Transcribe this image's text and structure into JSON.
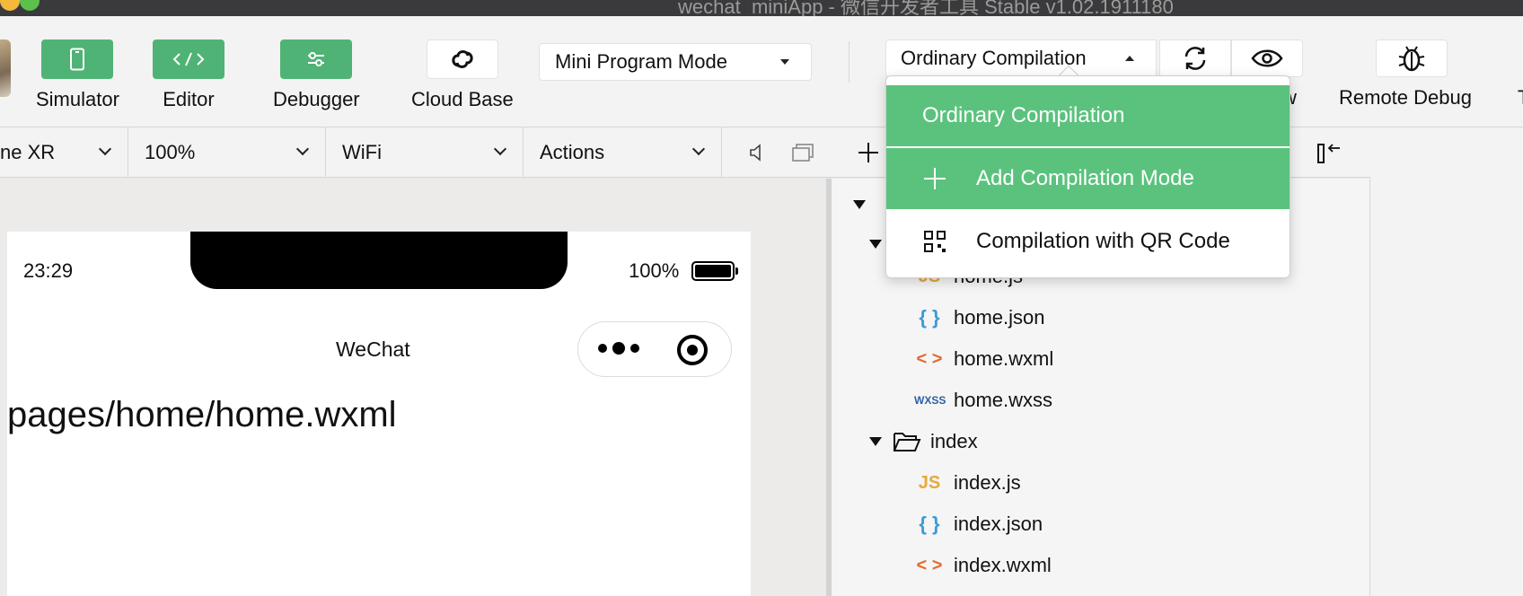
{
  "window": {
    "title": "wechat_miniApp - 微信开发者工具 Stable v1.02.1911180"
  },
  "toolbar": {
    "simulator_label": "Simulator",
    "editor_label": "Editor",
    "debugger_label": "Debugger",
    "cloud_label": "Cloud Base",
    "mode_value": "Mini Program Mode",
    "compile_value": "Ordinary Compilation",
    "preview_label_partial": "w",
    "remote_debug_label": "Remote Debug",
    "more_label_partial": "T"
  },
  "subbar": {
    "device": "ne XR",
    "zoom": "100%",
    "network": "WiFi",
    "actions": "Actions"
  },
  "simulator": {
    "time": "23:29",
    "battery": "100%",
    "nav_title": "WeChat",
    "page_path": "pages/home/home.wxml"
  },
  "tree": {
    "files_home": [
      {
        "name": "home.js",
        "type": "js",
        "icon": "JS"
      },
      {
        "name": "home.json",
        "type": "json",
        "icon": "{ }"
      },
      {
        "name": "home.wxml",
        "type": "wxml",
        "icon": "< >"
      },
      {
        "name": "home.wxss",
        "type": "wxss",
        "icon": "WXSS"
      }
    ],
    "folder_index": "index",
    "files_index": [
      {
        "name": "index.js",
        "type": "js",
        "icon": "JS"
      },
      {
        "name": "index.json",
        "type": "json",
        "icon": "{ }"
      },
      {
        "name": "index.wxml",
        "type": "wxml",
        "icon": "< >"
      }
    ]
  },
  "menu": {
    "items": [
      {
        "label": "Ordinary Compilation"
      },
      {
        "label": "Add Compilation Mode"
      },
      {
        "label": "Compilation with QR Code"
      }
    ]
  },
  "colors": {
    "accent_green": "#5bc27d",
    "toolbar_green": "#4fb375"
  }
}
